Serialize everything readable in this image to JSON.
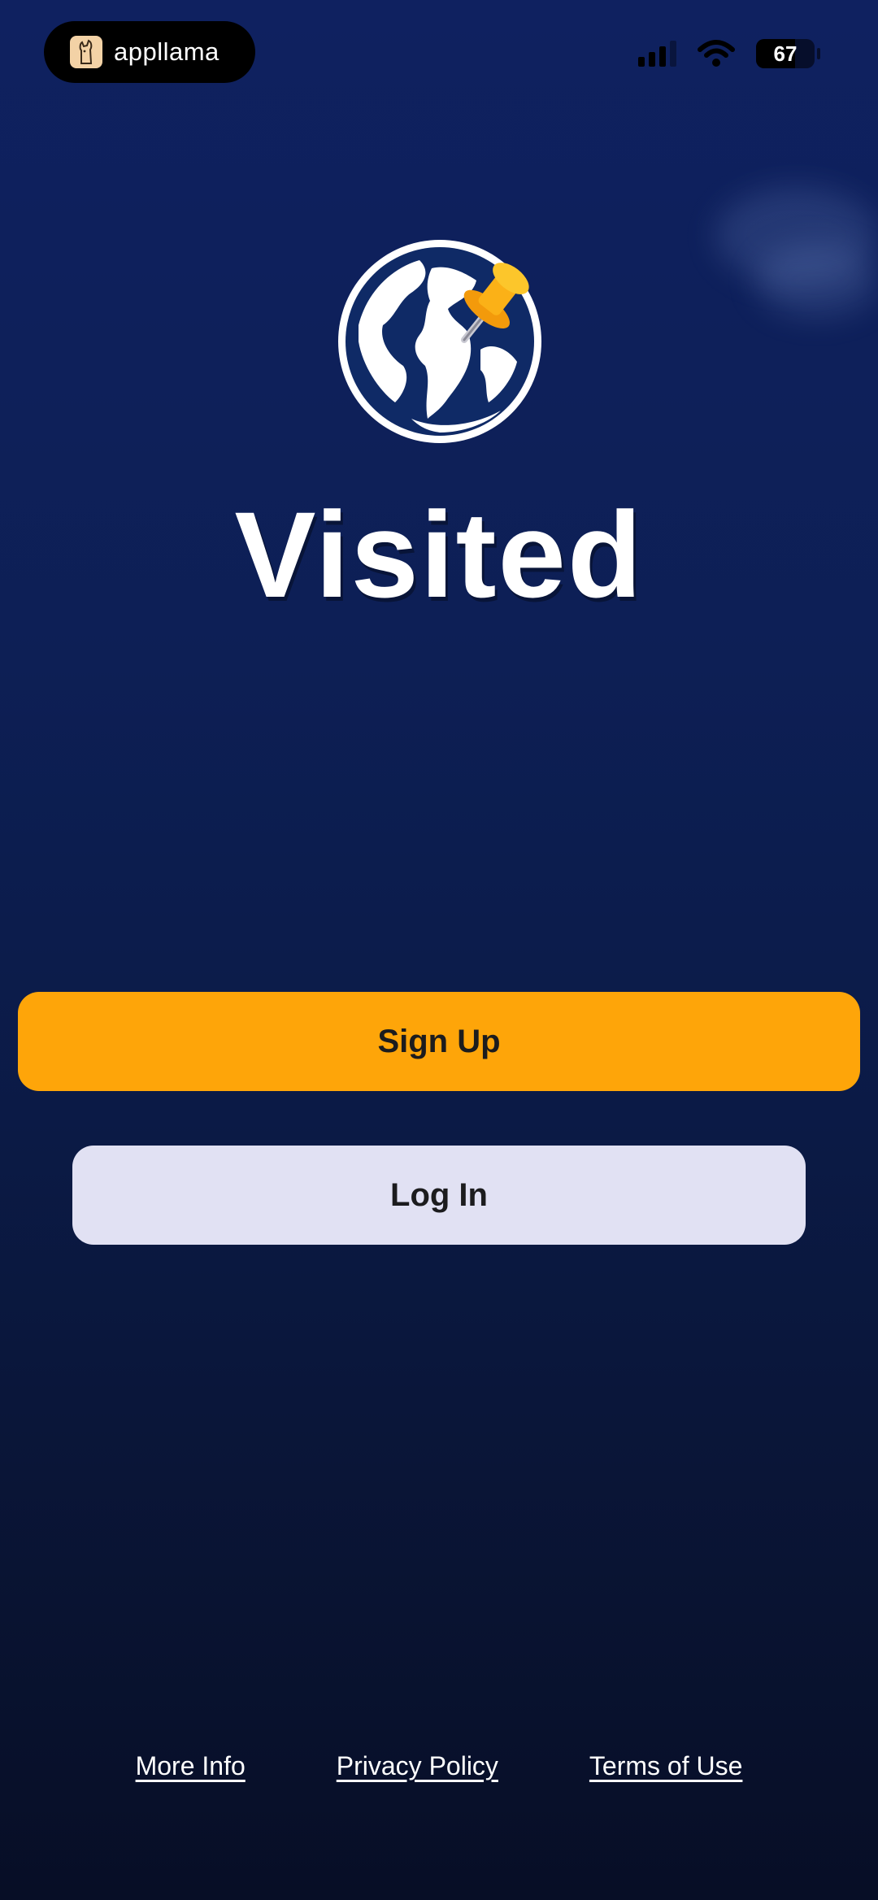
{
  "status_bar": {
    "app_badge": "appllama",
    "battery": "67",
    "battery_level_percent": 67
  },
  "app": {
    "title": "Visited",
    "icon": "globe-pin-icon"
  },
  "buttons": {
    "signup": "Sign Up",
    "login": "Log In"
  },
  "footer": {
    "more_info": "More Info",
    "privacy": "Privacy Policy",
    "terms": "Terms of Use"
  },
  "colors": {
    "background": "#0d1f55",
    "signup_bg": "#fea509",
    "login_bg": "#e1e1f3",
    "globe_fill": "#0f2a66",
    "pin": "#fbb117"
  }
}
